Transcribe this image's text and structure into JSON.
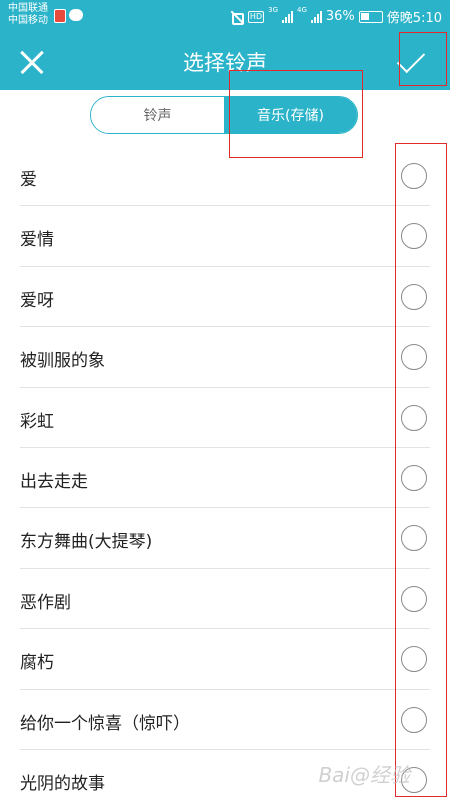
{
  "status_bar": {
    "carrier_1": "中国联通",
    "carrier_2": "中国移动",
    "hd": "HD",
    "net_1": "3G",
    "net_2": "4G",
    "battery_pct": "36%",
    "time": "傍晚5:10"
  },
  "toolbar": {
    "title": "选择铃声"
  },
  "segment": {
    "tab_ringtone": "铃声",
    "tab_music": "音乐(存储)",
    "active": "music"
  },
  "list": {
    "items": [
      {
        "label": "爱"
      },
      {
        "label": "爱情"
      },
      {
        "label": "爱呀"
      },
      {
        "label": "被驯服的象"
      },
      {
        "label": "彩虹"
      },
      {
        "label": "出去走走"
      },
      {
        "label": "东方舞曲(大提琴)"
      },
      {
        "label": "恶作剧"
      },
      {
        "label": "腐朽"
      },
      {
        "label": "给你一个惊喜（惊吓）"
      },
      {
        "label": "光阴的故事"
      }
    ]
  },
  "watermark": "Bai@经验",
  "colors": {
    "accent": "#2bb3c9",
    "annotation": "#e12b2b"
  }
}
